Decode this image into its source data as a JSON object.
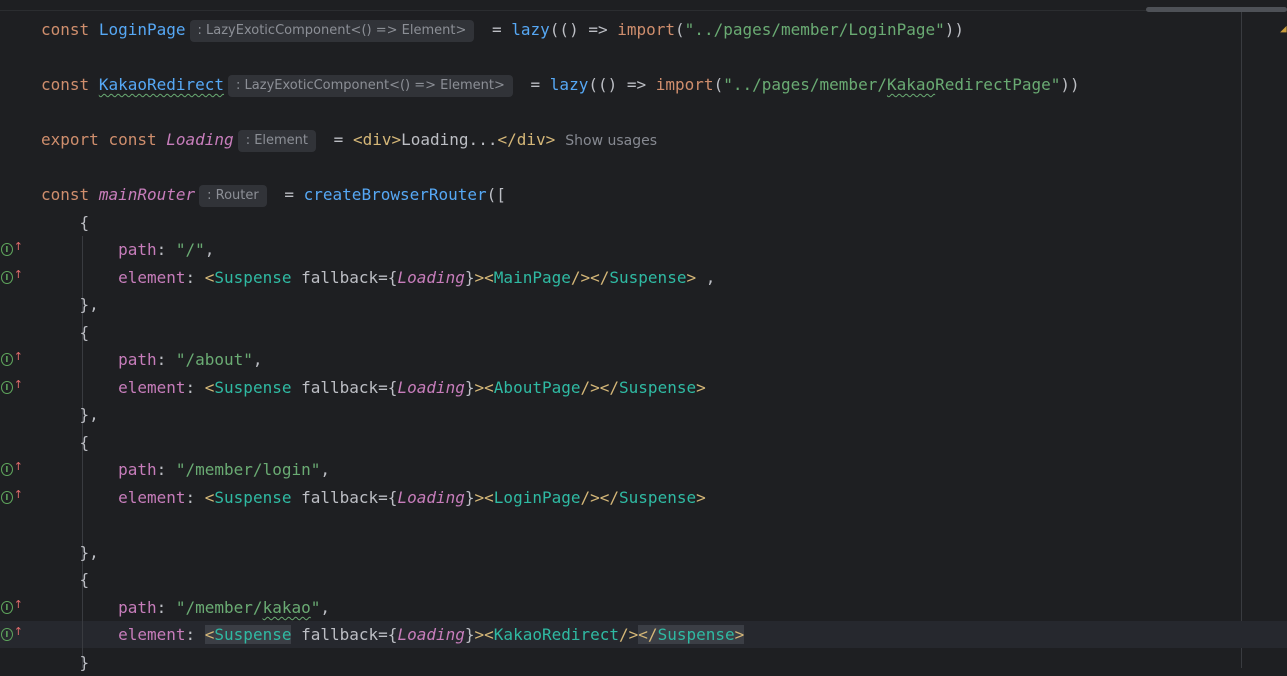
{
  "editor": {
    "colors": {
      "background": "#1e1f22",
      "keyword": "#cf8e6d",
      "declaration": "#56a8f5",
      "string": "#6aab73",
      "jsx_tag": "#2fbaa3",
      "jsx_bracket": "#d5b778",
      "property": "#c77dbb",
      "inlay_hint_bg": "#313338"
    },
    "gutter_icon": {
      "name": "implementation-overrides-icon",
      "glyph_circle": "I",
      "glyph_arrow": "↑"
    },
    "lines": {
      "l1": {
        "kw_const": "const",
        "name": "LoginPage",
        "hint": ": LazyExoticComponent<() => Element>",
        "assign": " = ",
        "fn": "lazy",
        "args_open": "(() => ",
        "kw_import": "import",
        "paren_open": "(",
        "path": "\"../pages/member/LoginPage\"",
        "close": "))"
      },
      "l2": {
        "kw_const": "const",
        "name": "KakaoRedirect",
        "hint": ": LazyExoticComponent<() => Element>",
        "assign": " = ",
        "fn": "lazy",
        "args_open": "(() => ",
        "kw_import": "import",
        "paren_open": "(",
        "path_start": "\"../pages/member/",
        "path_typo": "Kakao",
        "path_end": "RedirectPage\"",
        "close": "))"
      },
      "l3": {
        "kw_export": "export",
        "kw_const": "const",
        "name": "Loading",
        "hint": ": Element",
        "assign": " = ",
        "tag_open": "<",
        "tag_name": "div",
        "tag_close": ">",
        "text": "Loading...",
        "end_open": "</",
        "end_name": "div",
        "end_close": ">",
        "usages": "Show usages"
      },
      "l4": {
        "kw_const": "const",
        "name": "mainRouter",
        "hint": ": Router",
        "assign": " = ",
        "fn": "createBrowserRouter",
        "open": "(["
      },
      "obj_open": "{",
      "obj_close": "},",
      "path_key": "path",
      "element_key": "element",
      "colon": ": ",
      "comma": ",",
      "jsx": {
        "lt": "<",
        "gt": ">",
        "suspense": "Suspense",
        "fallback": "fallback",
        "eq_brace": "={",
        "loading_ref": "Loading",
        "brace_close": "}",
        "self_close": "/>",
        "end_open": "</",
        "trailing": " ,"
      },
      "routes": [
        {
          "path": "\"/\"",
          "component": "MainPage"
        },
        {
          "path": "\"/about\"",
          "component": "AboutPage"
        },
        {
          "path": "\"/member/login\"",
          "component": "LoginPage"
        },
        {
          "path_a": "\"/member/",
          "path_typo": "kakao",
          "path_b": "\"",
          "component": "KakaoRedirect"
        }
      ],
      "last": "}"
    }
  }
}
